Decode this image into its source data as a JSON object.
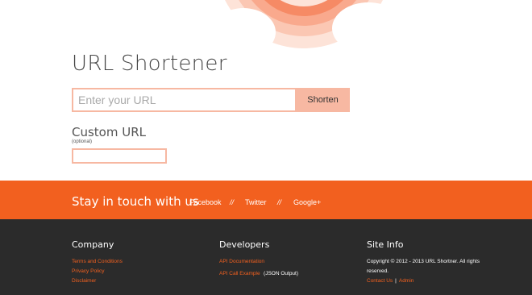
{
  "header": {
    "title": "URL Shortener"
  },
  "form": {
    "url_placeholder": "Enter your URL",
    "shorten_label": "Shorten",
    "custom_label": "Custom URL",
    "custom_hint": "(optional)",
    "custom_value": ""
  },
  "social": {
    "title": "Stay in touch with us",
    "links": [
      "Facebook",
      "Twitter",
      "Google+"
    ],
    "separator": "//"
  },
  "footer": {
    "company": {
      "heading": "Company",
      "links": [
        "Terms and Conditions",
        "Privacy Policy",
        "Disclaimer"
      ]
    },
    "developers": {
      "heading": "Developers",
      "api_docs": "API Documentation",
      "api_example": "API Call Example",
      "api_example_suffix": "(JSON Output)"
    },
    "site_info": {
      "heading": "Site Info",
      "copyright": "Copyright © 2012 - 2013 URL Shortner. All rights reserved.",
      "contact": "Contact Us",
      "separator": "|",
      "admin": "Admin"
    }
  },
  "colors": {
    "accent": "#f2601f",
    "accent_light": "#f7b8a2",
    "footer_bg": "#2b2b2b"
  }
}
